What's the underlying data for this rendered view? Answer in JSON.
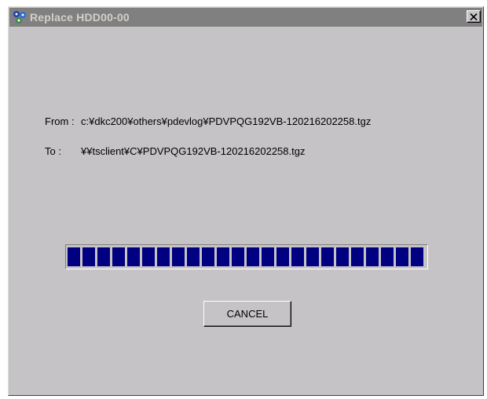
{
  "window": {
    "title": "Replace HDD00-00",
    "app_icon": "hdd-app-icon",
    "close_icon": "close-icon"
  },
  "transfer": {
    "from_label": "From :",
    "from_path": "c:¥dkc200¥others¥pdevlog¥PDVPQG192VB-120216202258.tgz",
    "to_label": "To :",
    "to_path": "¥¥tsclient¥C¥PDVPQG192VB-120216202258.tgz"
  },
  "progress": {
    "percent": 100,
    "color": "#000080"
  },
  "actions": {
    "cancel_label": "CANCEL"
  },
  "colors": {
    "face": "#c6c3c6",
    "titlebar": "#808080",
    "progress": "#000080"
  }
}
